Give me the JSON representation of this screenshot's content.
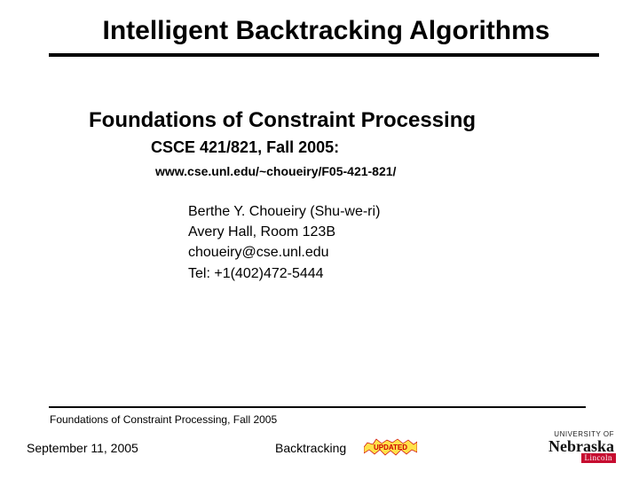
{
  "title": "Intelligent Backtracking Algorithms",
  "subtitle": "Foundations of Constraint Processing",
  "course": "CSCE 421/821, Fall 2005:",
  "url": "www.cse.unl.edu/~choueiry/F05-421-821/",
  "author": {
    "name": "Berthe Y. Choueiry (Shu-we-ri)",
    "office": "Avery Hall, Room 123B",
    "email": "choueiry@cse.unl.edu",
    "phone": "Tel: +1(402)472-5444"
  },
  "footer": {
    "course": "Foundations of Constraint Processing, Fall 2005",
    "date": "September 11, 2005",
    "topic": "Backtracking",
    "badge": "UPDATED"
  },
  "logo": {
    "top": "UNIVERSITY OF",
    "main": "Nebraska",
    "ext": "Lincoln"
  }
}
